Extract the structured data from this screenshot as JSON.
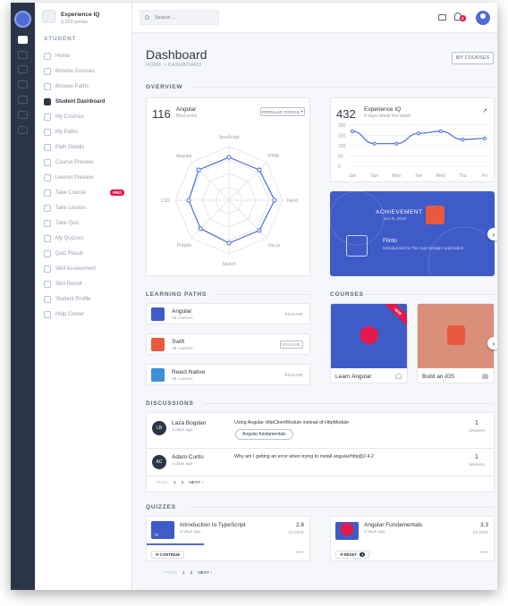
{
  "brand": {
    "title": "Experience IQ",
    "points": "2,300 points"
  },
  "sidebar": {
    "section": "STUDENT",
    "items": [
      {
        "label": "Home"
      },
      {
        "label": "Browse Courses"
      },
      {
        "label": "Browse Paths"
      },
      {
        "label": "Student Dashboard",
        "active": true
      },
      {
        "label": "My Courses"
      },
      {
        "label": "My Paths"
      },
      {
        "label": "Path Details"
      },
      {
        "label": "Course Preview"
      },
      {
        "label": "Lesson Preview"
      },
      {
        "label": "Take Course",
        "badge": "PRO"
      },
      {
        "label": "Take Lesson"
      },
      {
        "label": "Take Quiz"
      },
      {
        "label": "My Quizzes"
      },
      {
        "label": "Quiz Result"
      },
      {
        "label": "Skill Assessment"
      },
      {
        "label": "Skill Result"
      },
      {
        "label": "Student Profile"
      },
      {
        "label": "Help Center"
      }
    ]
  },
  "topbar": {
    "search_placeholder": "Search ...",
    "notification_count": "2"
  },
  "page": {
    "title": "Dashboard",
    "breadcrumb": "HOME > DASHBOARD",
    "my_courses_button": "MY COURSES"
  },
  "overview": {
    "heading": "OVERVIEW",
    "skills_card": {
      "score": "116",
      "topic": "Angular",
      "subtitle": "Best score",
      "button": "POPULAR TOPICS"
    },
    "iq_card": {
      "score": "432",
      "title": "Experience IQ",
      "subtitle": "4 days streak this week"
    }
  },
  "chart_data": [
    {
      "type": "radar",
      "categories": [
        "JavaScript",
        "HTML",
        "Flexo",
        "Vue.js",
        "Sketch",
        "Priciple",
        "CSS",
        "Angular"
      ],
      "values": [
        80,
        80,
        85,
        80,
        80,
        75,
        75,
        80
      ],
      "rmax": 100
    },
    {
      "type": "line",
      "categories": [
        "Sat",
        "Sun",
        "Mon",
        "Tue",
        "Wed",
        "Thu",
        "Fri"
      ],
      "values": [
        170,
        110,
        110,
        160,
        170,
        130,
        135
      ],
      "yticks": [
        "0",
        "50",
        "100",
        "150",
        "200"
      ],
      "ylim": [
        0,
        200
      ],
      "color": "#4f6bd7"
    }
  ],
  "achievement": {
    "label": "ACHIEVEMENT",
    "date": "Jun 5, 2018",
    "name": "Flinto",
    "description": "Introduction to The App Design Application"
  },
  "learning_paths": {
    "heading": "LEARNING PATHS",
    "items": [
      {
        "title": "Angular",
        "count": "18 courses",
        "action": "RESUME",
        "color": "#3f5bc8"
      },
      {
        "title": "Swift",
        "count": "18 courses",
        "action": "RESUME",
        "color": "#e8593d"
      },
      {
        "title": "React Native",
        "count": "18 courses",
        "action": "RESUME",
        "color": "#3c8fd9"
      }
    ]
  },
  "courses": {
    "heading": "COURSES",
    "items": [
      {
        "title": "Learn Angular",
        "ribbon": "NEW",
        "color": "#3f5bc8"
      },
      {
        "title": "Build an iOS",
        "color": "#d98f7a"
      }
    ]
  },
  "discussions": {
    "heading": "DISCUSSIONS",
    "items": [
      {
        "initials": "LB",
        "name": "Laza Bogdan",
        "time": "3 days ago",
        "question": "Using Angular HttpClientModule instead of HttpModule",
        "tag": "Angular fundamentals",
        "count": "1",
        "count_label": "answers"
      },
      {
        "initials": "AC",
        "name": "Adam Curtis",
        "time": "3 days ago",
        "question": "Why am I getting an error when trying to install angular/http@2.4.2",
        "count": "1",
        "count_label": "answers"
      }
    ],
    "pager": {
      "prev": "‹ PREV",
      "page1": "1",
      "page2": "2",
      "next": "NEXT ›"
    }
  },
  "quizzes": {
    "heading": "QUIZZES",
    "items": [
      {
        "title": "Introduction to TypeScript",
        "time": "3 days ago",
        "score": "2.8",
        "score_label": "SCORE",
        "action": "CONTINUE",
        "progress": 0.35,
        "thumb": "TS"
      },
      {
        "title": "Angular Fundamentals",
        "time": "3 days ago",
        "score": "3.3",
        "score_label": "SCORE",
        "action": "RESET",
        "action_count": "1"
      }
    ],
    "pager": {
      "prev": "‹ PREV",
      "page1": "1",
      "page2": "2",
      "next": "NEXT ›"
    }
  }
}
